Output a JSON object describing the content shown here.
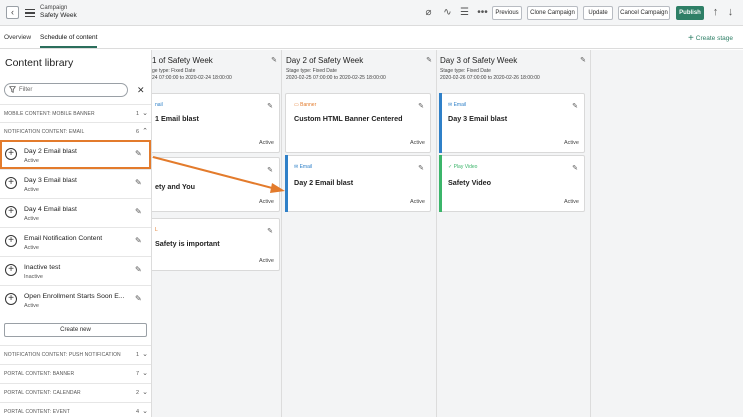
{
  "header": {
    "back_icon": "chevron-left-icon",
    "breadcrumb_top": "Campaign",
    "breadcrumb_bottom": "Safety Week",
    "buttons": {
      "previous": "Previous",
      "clone": "Clone Campaign",
      "update": "Update",
      "cancel": "Cancel Campaign",
      "publish": "Publish"
    },
    "accent": "#2e7f66"
  },
  "tabs": {
    "overview": "Overview",
    "schedule": "Schedule of content",
    "create_stage": "Create stage"
  },
  "sidebar": {
    "title": "Content library",
    "filter_placeholder": "Filter",
    "sections_top": [
      {
        "label": "MOBILE CONTENT: MOBILE BANNER",
        "count": "1"
      },
      {
        "label": "NOTIFICATION CONTENT: EMAIL",
        "count": "6"
      }
    ],
    "items": [
      {
        "name": "Day 2 Email blast",
        "status": "Active"
      },
      {
        "name": "Day 3 Email blast",
        "status": "Active"
      },
      {
        "name": "Day 4 Email blast",
        "status": "Active"
      },
      {
        "name": "Email Notification Content",
        "status": "Active"
      },
      {
        "name": "Inactive test",
        "status": "Inactive"
      },
      {
        "name": "Open Enrollment Starts Soon E...",
        "status": "Active"
      }
    ],
    "create_new": "Create new",
    "sections_bottom": [
      {
        "label": "NOTIFICATION CONTENT: PUSH NOTIFICATION",
        "count": "1"
      },
      {
        "label": "PORTAL CONTENT: BANNER",
        "count": "7"
      },
      {
        "label": "PORTAL CONTENT: CALENDAR",
        "count": "2"
      },
      {
        "label": "PORTAL CONTENT: EVENT",
        "count": "4"
      }
    ]
  },
  "stages": [
    {
      "title": "1 of Safety Week",
      "type": "ge type: Fixed Date",
      "dates": "24 07:00:00 to 2020-02-24 18:00:00",
      "cards": [
        {
          "type": "nail",
          "title": "1 Email blast",
          "status": "Active",
          "color": "#2f80c8"
        },
        {
          "type": "",
          "title": "ety and You",
          "status": "Active",
          "color": "#2f80c8"
        },
        {
          "type": "L",
          "title": "Safety is important",
          "status": "Active",
          "color": "#e37b2c"
        }
      ]
    },
    {
      "title": "Day 2 of Safety Week",
      "type": "Stage type: Fixed Date",
      "dates": "2020-02-25 07:00:00 to 2020-02-25 18:00:00",
      "cards": [
        {
          "type": "Banner",
          "title": "Custom HTML Banner Centered",
          "status": "Active",
          "color": "#e37b2c"
        },
        {
          "type": "Email",
          "title": "Day 2 Email blast",
          "status": "Active",
          "color": "#2f80c8"
        }
      ]
    },
    {
      "title": "Day 3 of Safety Week",
      "type": "Stage type: Fixed Date",
      "dates": "2020-02-26 07:00:00 to 2020-02-26 18:00:00",
      "cards": [
        {
          "type": "Email",
          "title": "Day 3 Email blast",
          "status": "Active",
          "color": "#2f80c8"
        },
        {
          "type": "Play Video",
          "title": "Safety Video",
          "status": "Active",
          "color": "#3bb56a"
        }
      ]
    }
  ],
  "annotation_color": "#e37b2c"
}
